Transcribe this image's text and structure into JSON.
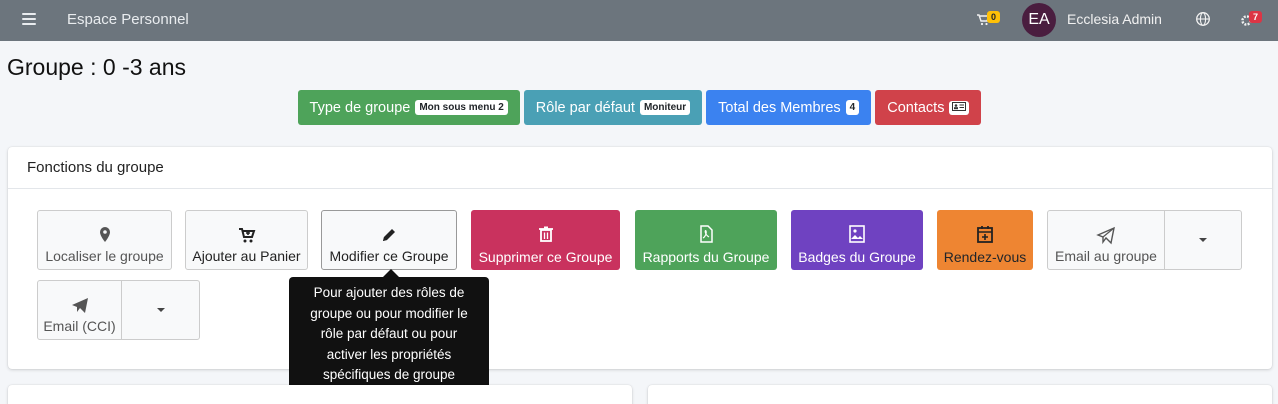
{
  "navbar": {
    "brand": "Espace Personnel",
    "cart_count": "0",
    "avatar_initials": "EA",
    "username": "Ecclesia Admin",
    "settings_count": "7"
  },
  "page": {
    "title": "Groupe : 0 -3 ans"
  },
  "info_buttons": [
    {
      "label": "Type de groupe",
      "pill": "Mon sous menu 2",
      "color": "#4ea35a"
    },
    {
      "label": "Rôle par défaut",
      "pill": "Moniteur",
      "color": "#4aa0b5"
    },
    {
      "label": "Total des Membres",
      "pill": "4",
      "color": "#3b82f0"
    },
    {
      "label": "Contacts",
      "pill_icon": "contact-card-icon",
      "color": "#d0424a"
    }
  ],
  "functions": {
    "header": "Fonctions du groupe",
    "buttons": [
      {
        "label": "Localiser le groupe",
        "icon": "map-marker-icon"
      },
      {
        "label": "Ajouter au Panier",
        "icon": "cart-plus-icon"
      },
      {
        "label": "Modifier ce Groupe",
        "icon": "pencil-icon"
      },
      {
        "label": "Supprimer ce Groupe",
        "icon": "trash-icon",
        "color": "#c9325e"
      },
      {
        "label": "Rapports du Groupe",
        "icon": "file-pdf-icon",
        "color": "#4ea35a"
      },
      {
        "label": "Badges du Groupe",
        "icon": "image-icon",
        "color": "#6f42c1"
      },
      {
        "label": "Rendez-vous",
        "icon": "calendar-plus-icon",
        "color": "#ee8532"
      },
      {
        "label": "Email au groupe",
        "icon": "paper-plane-icon"
      },
      {
        "label": "Email (CCI)",
        "icon": "paper-plane-icon"
      }
    ]
  },
  "tooltip": {
    "line1": "Pour ajouter des rôles de",
    "line2": "groupe ou pour modifier le",
    "line3": "rôle par défaut ou pour",
    "line4": "activer les propriétés",
    "line5": "spécifiques de groupe"
  }
}
